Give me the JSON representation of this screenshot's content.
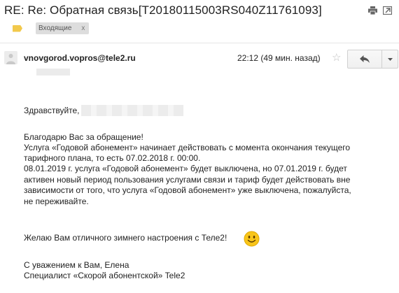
{
  "email": {
    "subject": "RE: Re: Обратная связь[T20180115003RS040Z11761093]",
    "label": "Входящие",
    "label_remove": "x",
    "sender": "vnovgorod.vopros@tele2.ru",
    "time": "22:12 (49 мин. назад)"
  },
  "body": {
    "greeting": "Здравствуйте,",
    "lines": [
      "Благодарю Вас за обращение!",
      "Услуга «Годовой абонемент» начинает действовать с момента окончания текущего",
      "тарифного плана, то есть 07.02.2018 г. 00:00.",
      "08.01.2019 г. услуга «Годовой абонемент» будет выключена, но 07.01.2019 г. будет",
      "активен новый период пользования услугами связи и тариф будет действовать вне",
      "зависимости от того, что услуга «Годовой абонемент» уже выключена, пожалуйста,",
      "не переживайте."
    ],
    "wish": "Желаю Вам отличного зимнего настроения с Теле2!",
    "regards": "С уважением к Вам, Елена",
    "signature": "Специалист «Скорой абонентской» Tele2"
  },
  "icons": {
    "print": "print-icon",
    "new_window": "open-in-new-window-icon",
    "label": "label-tag-icon",
    "avatar": "person-icon",
    "star": "star-icon",
    "reply": "reply-icon",
    "more": "dropdown-arrow-icon",
    "smiley": "smiley-emoji-icon"
  },
  "colors": {
    "label_tag": "#f2c94c",
    "smiley": "#f8c51a"
  }
}
